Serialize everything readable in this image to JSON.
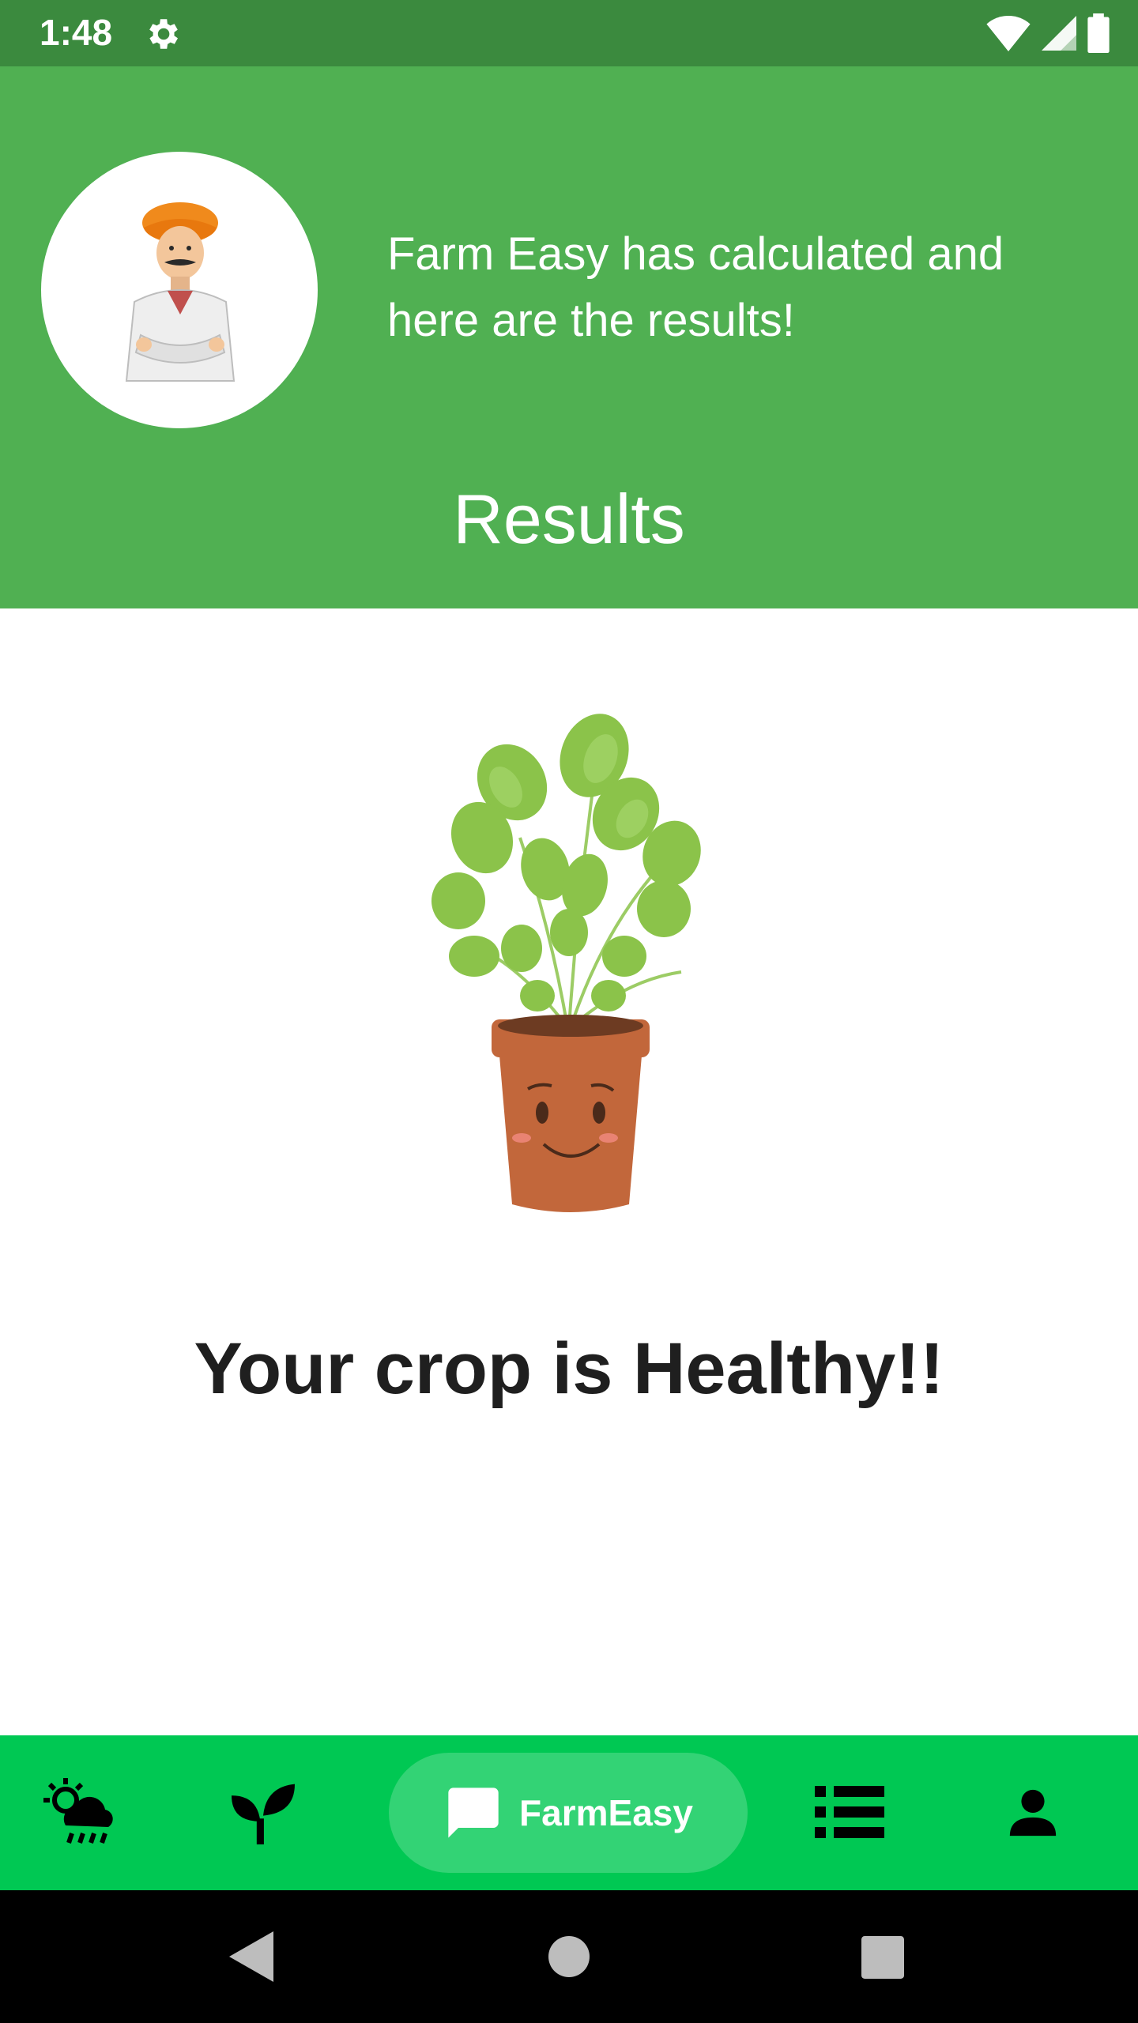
{
  "status_bar": {
    "time": "1:48",
    "icons": [
      "gear-icon",
      "wifi-icon",
      "signal-icon",
      "battery-icon"
    ],
    "background": "#3b8a3e"
  },
  "header": {
    "message": "Farm Easy has calculated and here are the results!",
    "title": "Results",
    "background": "#50b052",
    "avatar_icon": "farmer-avatar"
  },
  "result": {
    "illustration": "smiling-potted-plant",
    "text": "Your crop is Healthy!!"
  },
  "bottom_nav": {
    "background": "#00c853",
    "active_background": "#33d375",
    "items": [
      {
        "icon": "weather-icon"
      },
      {
        "icon": "sprout-icon"
      },
      {
        "icon": "chat-icon",
        "label": "FarmEasy",
        "active": true
      },
      {
        "icon": "list-icon"
      },
      {
        "icon": "person-icon"
      }
    ]
  },
  "system_nav": {
    "icons": [
      "back-icon",
      "home-icon",
      "recents-icon"
    ]
  }
}
